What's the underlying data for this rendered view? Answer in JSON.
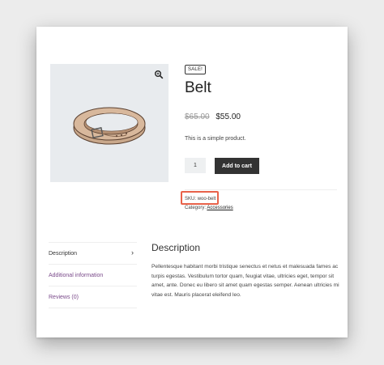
{
  "badge": "SALE!",
  "product": {
    "title": "Belt",
    "price_old": "$65.00",
    "price_new": "$55.00",
    "short_description": "This is a simple product.",
    "quantity": "1",
    "add_to_cart_label": "Add to cart",
    "sku_label": "SKU:",
    "sku_value": "woo-belt",
    "category_label": "Category:",
    "category_value": "Accessories"
  },
  "tabs": [
    {
      "label": "Description",
      "active": true
    },
    {
      "label": "Additional information",
      "active": false
    },
    {
      "label": "Reviews (0)",
      "active": false
    }
  ],
  "panel": {
    "title": "Description",
    "text": "Pellentesque habitant morbi tristique senectus et netus et malesuada fames ac turpis egestas. Vestibulum tortor quam, feugiat vitae, ultricies eget, tempor sit amet, ante. Donec eu libero sit amet quam egestas semper. Aenean ultricies mi vitae est. Mauris placerat eleifend leo."
  },
  "icons": {
    "zoom": "magnifier-icon",
    "tab_arrow": "chevron-right-icon"
  },
  "colors": {
    "button_bg": "#333333",
    "highlight": "#e8624a",
    "tab_link": "#7a4a8a"
  }
}
